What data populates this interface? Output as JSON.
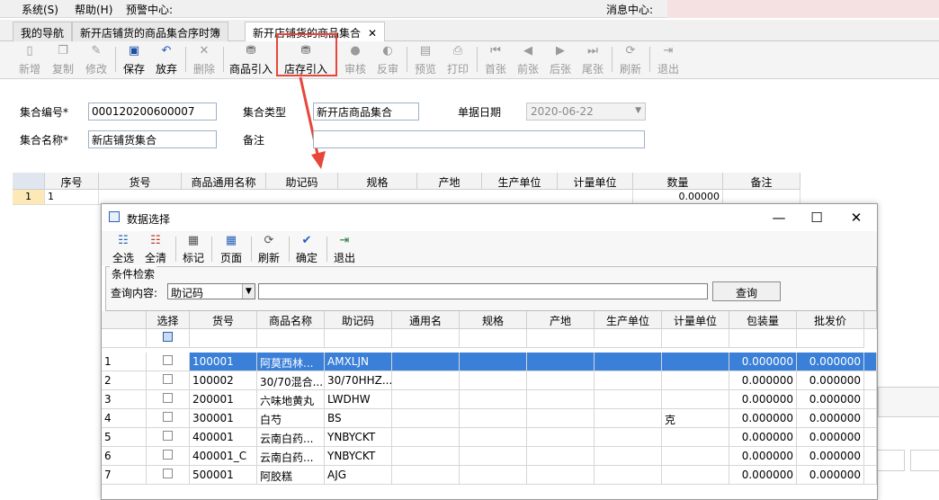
{
  "menu": {
    "items": [
      "系统(S)",
      "帮助(H)",
      "预警中心:"
    ],
    "message_center": "消息中心:"
  },
  "tabs": [
    {
      "label": "我的导航"
    },
    {
      "label": "新开店铺货的商品集合序时簿"
    },
    {
      "label": "新开店铺货的商品集合",
      "close": "✕"
    }
  ],
  "toolbar": {
    "buttons": [
      {
        "label": "新增",
        "icon": "new-doc-icon",
        "enabled": false
      },
      {
        "label": "复制",
        "icon": "copy-icon",
        "enabled": false
      },
      {
        "label": "修改",
        "icon": "edit-icon",
        "enabled": false
      },
      {
        "label": "保存",
        "icon": "save-icon",
        "enabled": true
      },
      {
        "label": "放弃",
        "icon": "undo-icon",
        "enabled": true
      },
      {
        "label": "删除",
        "icon": "delete-icon",
        "enabled": false
      },
      {
        "label": "商品引入",
        "icon": "import-goods-icon",
        "enabled": true
      },
      {
        "label": "店存引入",
        "icon": "import-store-icon",
        "enabled": true
      },
      {
        "label": "审核",
        "icon": "approve-icon",
        "enabled": false
      },
      {
        "label": "反审",
        "icon": "unapprove-icon",
        "enabled": false
      },
      {
        "label": "预览",
        "icon": "preview-icon",
        "enabled": false
      },
      {
        "label": "打印",
        "icon": "print-icon",
        "enabled": false
      },
      {
        "label": "首张",
        "icon": "first-icon",
        "enabled": false
      },
      {
        "label": "前张",
        "icon": "prev-icon",
        "enabled": false
      },
      {
        "label": "后张",
        "icon": "next-icon",
        "enabled": false
      },
      {
        "label": "尾张",
        "icon": "last-icon",
        "enabled": false
      },
      {
        "label": "刷新",
        "icon": "refresh-icon",
        "enabled": false
      },
      {
        "label": "退出",
        "icon": "exit-icon",
        "enabled": false
      }
    ]
  },
  "form": {
    "code_label": "集合编号*",
    "code_value": "000120200600007",
    "type_label": "集合类型",
    "type_value": "新开店商品集合",
    "date_label": "单据日期",
    "date_value": "2020-06-22",
    "name_label": "集合名称*",
    "name_value": "新店铺货集合",
    "note_label": "备注",
    "note_value": ""
  },
  "main_grid": {
    "columns": [
      "序号",
      "货号",
      "商品通用名称",
      "助记码",
      "规格",
      "产地",
      "生产单位",
      "计量单位",
      "数量",
      "备注"
    ],
    "rows": [
      {
        "row_no": "1",
        "seq": "1",
        "qty": "0.00000"
      }
    ]
  },
  "dialog": {
    "title": "数据选择",
    "toolbar": [
      {
        "label": "全选",
        "icon": "select-all-icon"
      },
      {
        "label": "全清",
        "icon": "clear-all-icon"
      },
      {
        "label": "标记",
        "icon": "mark-icon"
      },
      {
        "label": "页面",
        "icon": "page-icon"
      },
      {
        "label": "刷新",
        "icon": "refresh-icon"
      },
      {
        "label": "确定",
        "icon": "checkmark-icon"
      },
      {
        "label": "退出",
        "icon": "exit-icon"
      }
    ],
    "condition_legend": "条件检索",
    "query_label": "查询内容:",
    "query_field": "助记码",
    "query_text": "",
    "query_button": "查询",
    "columns": [
      "选择",
      "货号",
      "商品名称",
      "助记码",
      "通用名",
      "规格",
      "产地",
      "生产单位",
      "计量单位",
      "包装量",
      "批发价"
    ],
    "rows": [
      {
        "no": "1",
        "code": "100001",
        "name": "阿莫西林...",
        "mnemonic": "AMXLJN",
        "unit": "",
        "pack": "0.000000",
        "price": "0.000000",
        "selected": true
      },
      {
        "no": "2",
        "code": "100002",
        "name": "30/70混合...",
        "mnemonic": "30/70HHZ...",
        "unit": "",
        "pack": "0.000000",
        "price": "0.000000",
        "selected": false
      },
      {
        "no": "3",
        "code": "200001",
        "name": "六味地黄丸",
        "mnemonic": "LWDHW",
        "unit": "",
        "pack": "0.000000",
        "price": "0.000000",
        "selected": false
      },
      {
        "no": "4",
        "code": "300001",
        "name": "白芍",
        "mnemonic": "BS",
        "unit": "克",
        "pack": "0.000000",
        "price": "0.000000",
        "selected": false
      },
      {
        "no": "5",
        "code": "400001",
        "name": "云南白药...",
        "mnemonic": "YNBYCKT",
        "unit": "",
        "pack": "0.000000",
        "price": "0.000000",
        "selected": false
      },
      {
        "no": "6",
        "code": "400001_C",
        "name": "云南白药...",
        "mnemonic": "YNBYCKT",
        "unit": "",
        "pack": "0.000000",
        "price": "0.000000",
        "selected": false
      },
      {
        "no": "7",
        "code": "500001",
        "name": "阿胶糕",
        "mnemonic": "AJG",
        "unit": "",
        "pack": "0.000000",
        "price": "0.000000",
        "selected": false
      }
    ]
  },
  "colors": {
    "annotation_red": "#e8463a",
    "selection_blue": "#3a7fd8",
    "main_row_highlight": "#fde8b8"
  }
}
